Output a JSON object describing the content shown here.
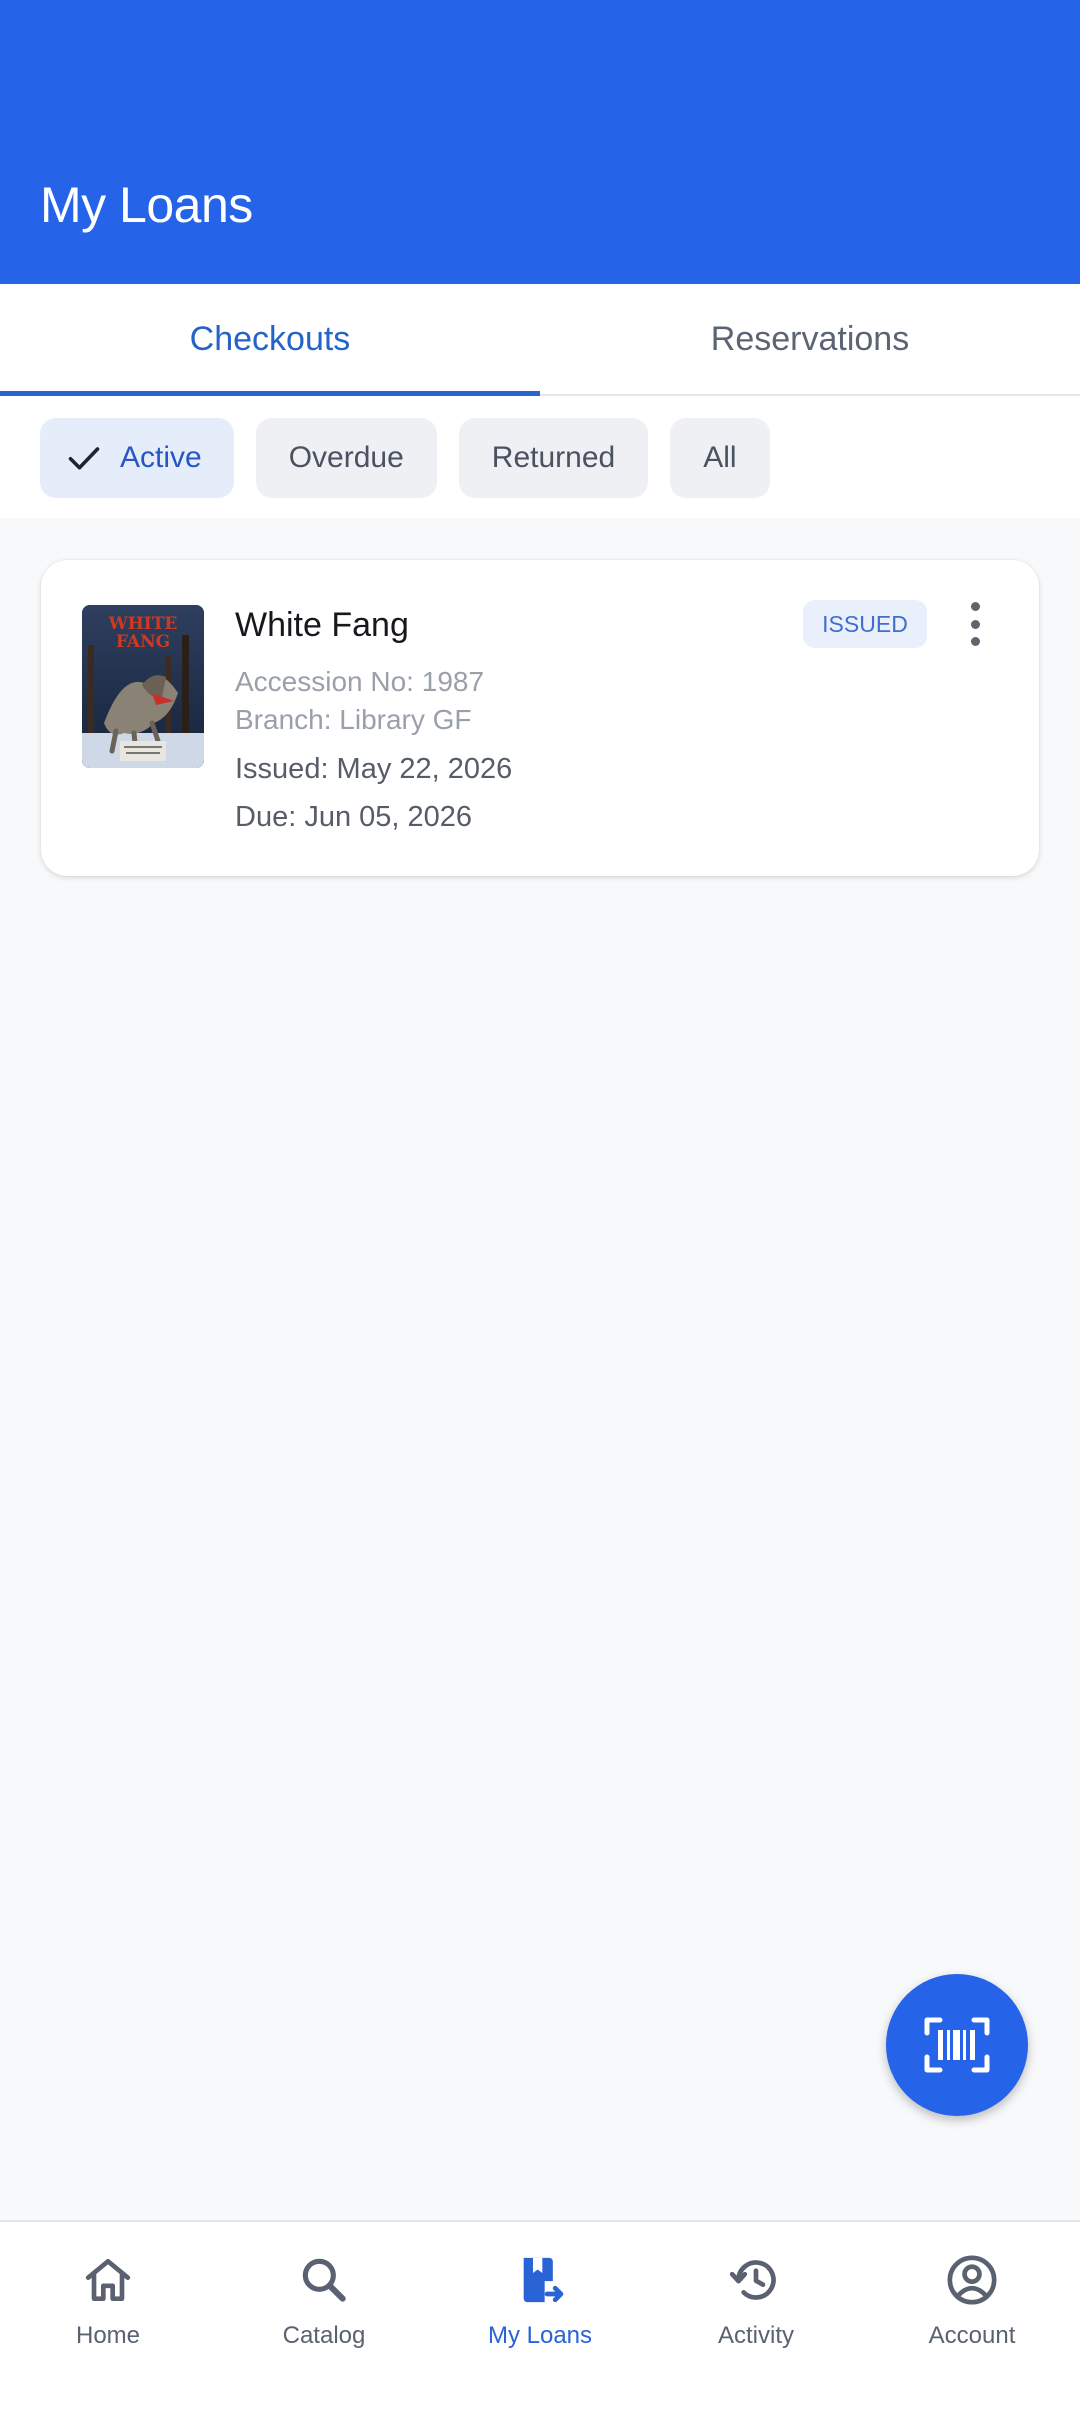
{
  "header": {
    "title": "My Loans"
  },
  "tabs": [
    {
      "label": "Checkouts",
      "active": true
    },
    {
      "label": "Reservations",
      "active": false
    }
  ],
  "filters": {
    "active": "Active",
    "overdue": "Overdue",
    "returned": "Returned",
    "all": "All",
    "selected": "Active"
  },
  "loan": {
    "title": "White Fang",
    "accession": "Accession No: 1987",
    "branch": "Branch: Library GF",
    "issued": "Issued: May 22, 2026",
    "due": "Due: Jun 05, 2026",
    "status": "ISSUED",
    "cover_title": "WHITE FANG"
  },
  "fab": {
    "icon": "barcode-scan-icon"
  },
  "nav": {
    "home": "Home",
    "catalog": "Catalog",
    "loans": "My Loans",
    "activity": "Activity",
    "account": "Account",
    "active": "My Loans"
  },
  "colors": {
    "primary": "#2563e8",
    "accent_text": "#2563c9",
    "background": "#f8f9fb",
    "badge_bg": "#e9f0fc"
  }
}
